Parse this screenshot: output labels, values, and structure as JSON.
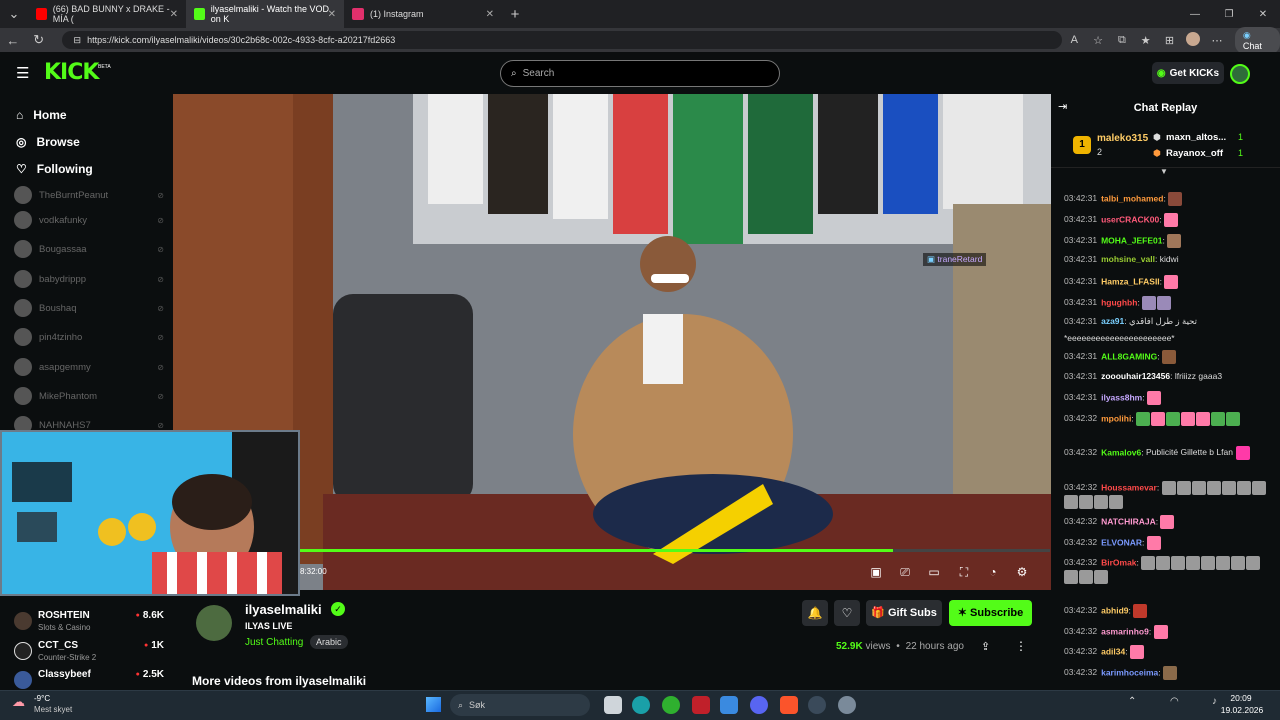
{
  "browser": {
    "tabs": [
      {
        "label": "(66) BAD BUNNY x DRAKE - MÍA (",
        "icon": "youtube-icon",
        "color": "#ff0000"
      },
      {
        "label": "ilyaselmaliki - Watch the VOD on K",
        "icon": "kick-icon",
        "color": "#53fc18"
      },
      {
        "label": "(1) Instagram",
        "icon": "instagram-icon",
        "color": "#e1306c"
      }
    ],
    "url": "https://kick.com/ilyaselmaliki/videos/30c2b68c-002c-4933-8cfc-a20217fd2663",
    "chat_button": "Chat"
  },
  "header": {
    "logo": "KICK",
    "beta": "BETA",
    "search_placeholder": "Search",
    "get_kicks": "Get KICKs"
  },
  "sidebar": {
    "nav": [
      {
        "label": "Home",
        "icon": "home-icon"
      },
      {
        "label": "Browse",
        "icon": "compass-icon"
      },
      {
        "label": "Following",
        "icon": "heart-icon"
      }
    ],
    "following": [
      "TheBurntPeanut",
      "vodkafunky",
      "Bougassaa",
      "babydrippp",
      "Boushaq",
      "pin4tzinho",
      "asapgemmy",
      "MikePhantom",
      "NAHNAHS7"
    ],
    "recommended": [
      {
        "name": "ROSHTEIN",
        "category": "Slots & Casino",
        "viewers": "8.6K"
      },
      {
        "name": "CCT_CS",
        "category": "Counter-Strike 2",
        "viewers": "1K"
      },
      {
        "name": "Classybeef",
        "category": "",
        "viewers": "2.5K"
      }
    ]
  },
  "player": {
    "timestamp": "8:32:00",
    "progress": 0.79,
    "overlay_user": "traneRetard"
  },
  "channel": {
    "name": "ilyaselmaliki",
    "title": "ILYAS LIVE",
    "category": "Just Chatting",
    "tag": "Arabic",
    "gift_subs": "Gift Subs",
    "subscribe": "Subscribe",
    "views": "52.9K",
    "views_label": "views",
    "ago": "22 hours ago",
    "more_videos": "More videos from ilyaselmaliki"
  },
  "chat": {
    "title": "Chat Replay",
    "top_gifters": [
      {
        "name": "maleko315",
        "count": "2"
      },
      {
        "name": "maxn_altos...",
        "count": "1"
      },
      {
        "name": "Rayanox_off",
        "count": "1"
      }
    ],
    "messages": [
      {
        "time": "03:42:31",
        "user": "talbi_mohamed",
        "color": "#ff9a3c",
        "text": "",
        "emotes": [
          "#8a4a3a"
        ]
      },
      {
        "time": "03:42:31",
        "user": "userCRACK00",
        "color": "#ff5a7a",
        "text": "",
        "emotes": [
          "#ff7aa8"
        ]
      },
      {
        "time": "03:42:31",
        "user": "MOHA_JEFE01",
        "color": "#53fc18",
        "text": "",
        "emotes": [
          "#a0775a"
        ]
      },
      {
        "time": "03:42:31",
        "user": "mohsine_vall",
        "color": "#9acd32",
        "text": "kidwi",
        "emotes": []
      },
      {
        "time": "03:42:31",
        "user": "Hamza_LFASII",
        "color": "#ffcc66",
        "text": "",
        "emotes": [
          "#ff7aa8"
        ]
      },
      {
        "time": "03:42:31",
        "user": "hgughbh",
        "color": "#ff4a4a",
        "text": "",
        "emotes": [
          "#9a8ab8",
          "#9a8ab8"
        ]
      },
      {
        "time": "03:42:31",
        "user": "aza91",
        "color": "#7ad0ff",
        "text": "تحية ز طرل افاقدي",
        "emotes": []
      },
      {
        "time": "",
        "user": "",
        "color": "#ddd",
        "text": "*eeeeeeeeeeeeeeeeeeeeee*",
        "emotes": []
      },
      {
        "time": "03:42:31",
        "user": "ALL8GAMING",
        "color": "#53fc18",
        "text": "",
        "emotes": [
          "#8a5a3a"
        ]
      },
      {
        "time": "03:42:31",
        "user": "zooouhair123456",
        "color": "#ffffff",
        "text": "lfriiizz gaaa3",
        "emotes": []
      },
      {
        "time": "03:42:31",
        "user": "ilyass8hm",
        "color": "#c6a8ff",
        "text": "",
        "emotes": [
          "#ff7aa8"
        ]
      },
      {
        "time": "03:42:32",
        "user": "mpolihi",
        "color": "#ff9a3c",
        "text": "",
        "emotes": [
          "#4caf50",
          "#ff7aa8",
          "#4caf50",
          "#ff7aa8",
          "#ff7aa8",
          "#4caf50",
          "#4caf50"
        ]
      },
      {
        "time": "03:42:32",
        "user": "Kamalov6",
        "color": "#53fc18",
        "text": "Publicité Gillette b Lfan",
        "emotes": [
          "#ff3aa8"
        ]
      },
      {
        "time": "03:42:32",
        "user": "Houssamevar",
        "color": "#ff4a4a",
        "text": "",
        "emotes": [
          "#9a9a9a",
          "#9a9a9a",
          "#9a9a9a",
          "#9a9a9a",
          "#9a9a9a",
          "#9a9a9a",
          "#9a9a9a",
          "#9a9a9a",
          "#9a9a9a",
          "#9a9a9a",
          "#9a9a9a"
        ]
      },
      {
        "time": "03:42:32",
        "user": "NATCHIRAJA",
        "color": "#ff9ad0",
        "text": "",
        "emotes": [
          "#ff7aa8"
        ]
      },
      {
        "time": "03:42:32",
        "user": "ELVONAR",
        "color": "#7a9aff",
        "text": "",
        "emotes": [
          "#ff7aa8"
        ]
      },
      {
        "time": "03:42:32",
        "user": "BirOmak",
        "color": "#ff4a4a",
        "text": "",
        "emotes": [
          "#9a9a9a",
          "#9a9a9a",
          "#9a9a9a",
          "#9a9a9a",
          "#9a9a9a",
          "#9a9a9a",
          "#9a9a9a",
          "#9a9a9a",
          "#9a9a9a",
          "#9a9a9a",
          "#9a9a9a"
        ]
      },
      {
        "time": "03:42:32",
        "user": "abhid9",
        "color": "#ffcc66",
        "text": "",
        "emotes": [
          "#c0392b"
        ]
      },
      {
        "time": "03:42:32",
        "user": "asmarinho9",
        "color": "#ff9ad0",
        "text": "",
        "emotes": [
          "#ff7aa8"
        ]
      },
      {
        "time": "03:42:32",
        "user": "adil34",
        "color": "#ffcc66",
        "text": "",
        "emotes": [
          "#ff7aa8"
        ]
      },
      {
        "time": "03:42:32",
        "user": "karimhoceima",
        "color": "#7a9aff",
        "text": "",
        "emotes": [
          "#8a6a4a"
        ]
      }
    ]
  },
  "taskbar": {
    "weather_temp": "-9°C",
    "weather_desc": "Mest skyet",
    "search": "Søk",
    "time": "20:09",
    "date": "19.02.2026"
  }
}
